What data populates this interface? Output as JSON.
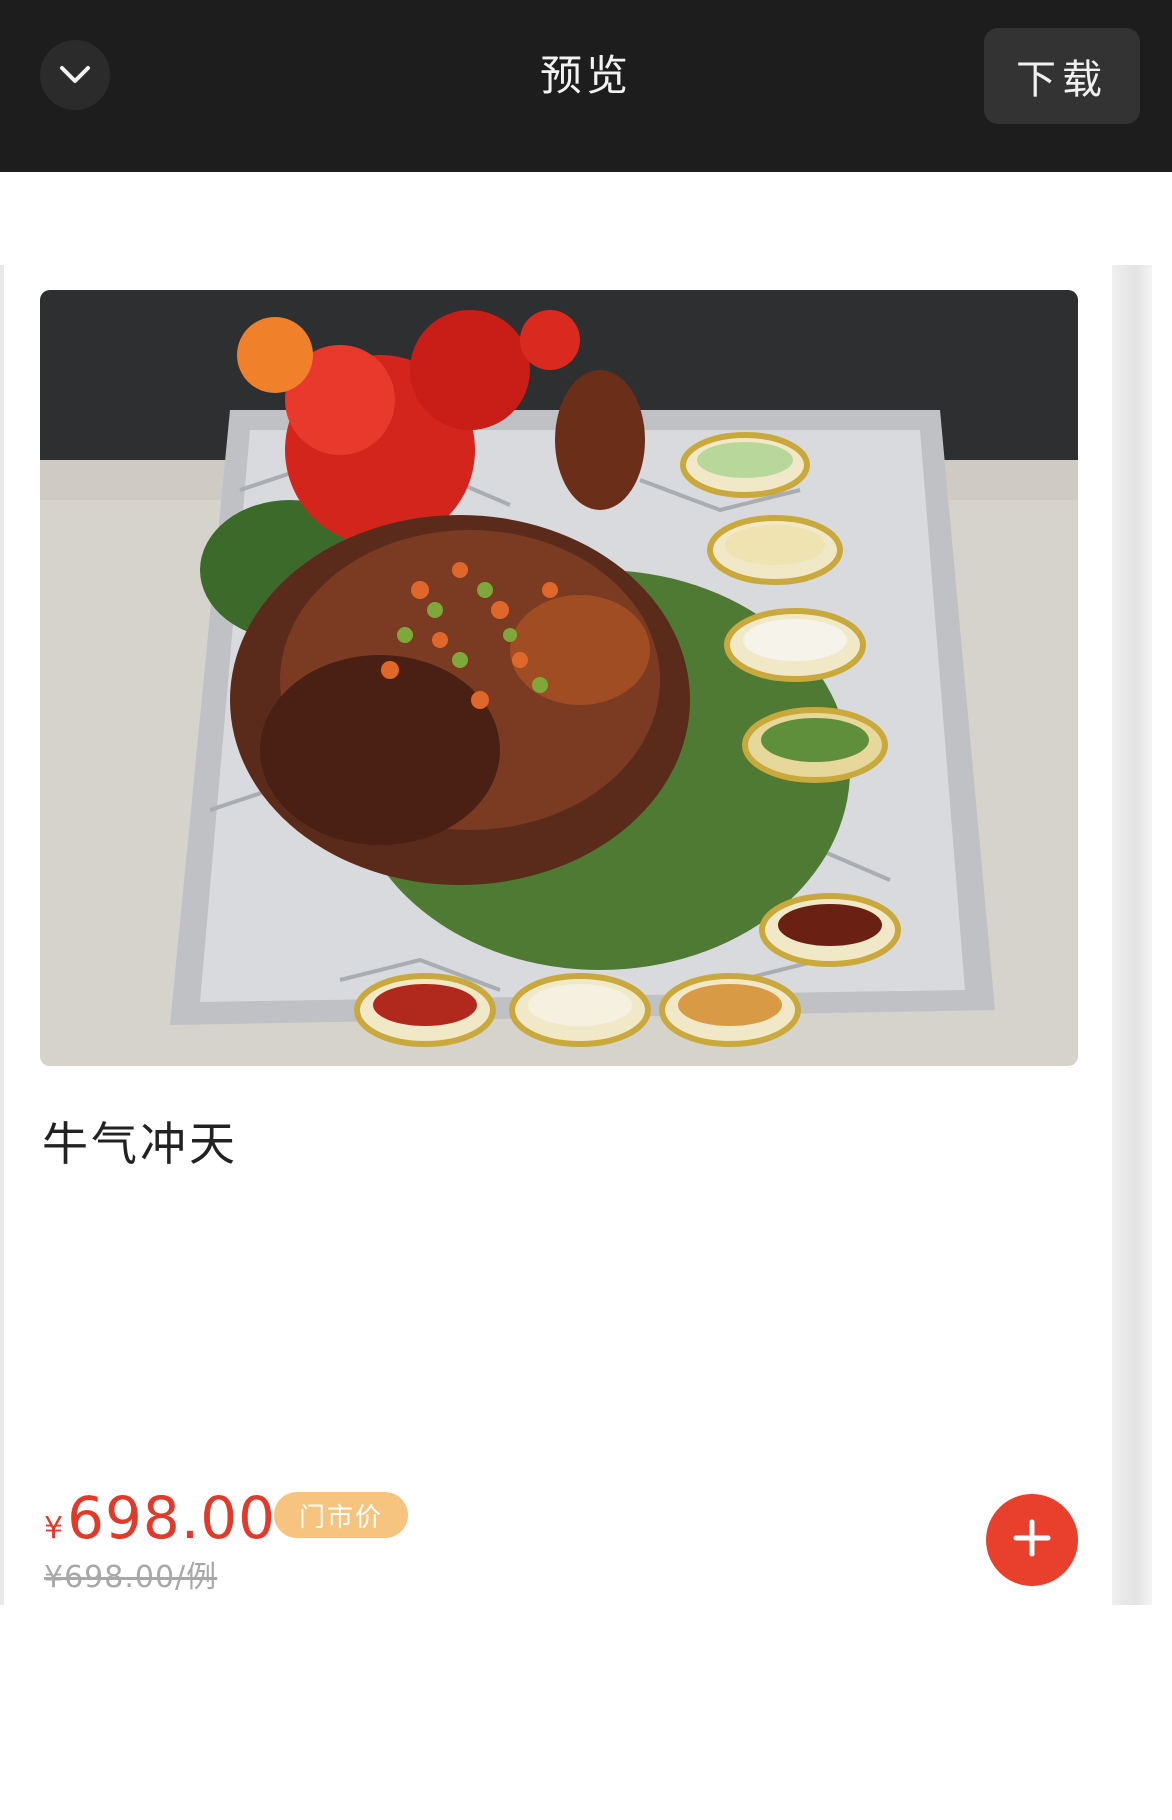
{
  "header": {
    "title": "预览",
    "download_label": "下载",
    "back_icon": "chevron-down-icon"
  },
  "colors": {
    "header_bg": "#1d1d1d",
    "price": "#e23a2a",
    "badge_bg": "#f6c47e",
    "add_button": "#e8402c"
  },
  "dish": {
    "name": "牛气冲天",
    "price_symbol": "¥",
    "price": "698.00",
    "price_tag": "门市价",
    "original_price": "¥698.00/例",
    "add_icon": "plus-icon"
  }
}
